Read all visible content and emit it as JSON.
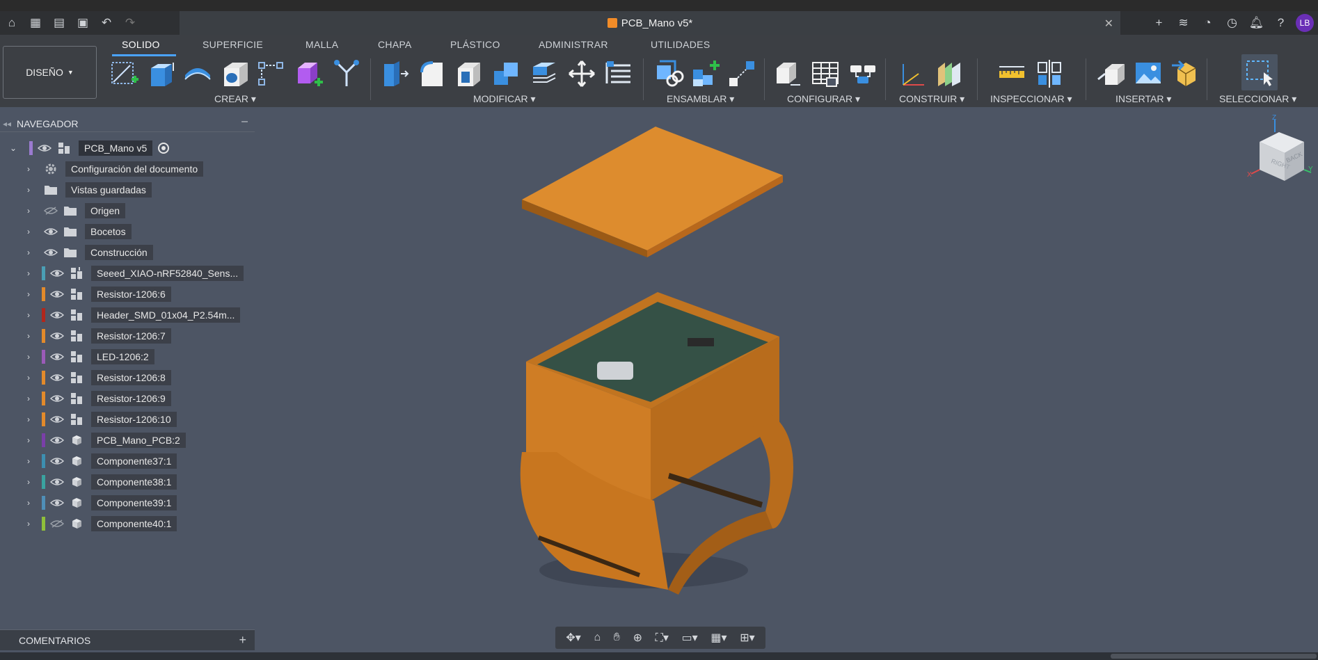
{
  "app": {
    "document_title": "PCB_Mano v5*",
    "user_initials": "LB"
  },
  "ribbon": {
    "workspace": "DISEÑO",
    "tabs": [
      "SOLIDO",
      "SUPERFICIE",
      "MALLA",
      "CHAPA",
      "PLÁSTICO",
      "ADMINISTRAR",
      "UTILIDADES"
    ],
    "active_tab": "SOLIDO",
    "groups": {
      "crear": "CREAR",
      "modificar": "MODIFICAR",
      "ensamblar": "ENSAMBLAR",
      "configurar": "CONFIGURAR",
      "construir": "CONSTRUIR",
      "inspeccionar": "INSPECCIONAR",
      "insertar": "INSERTAR",
      "seleccionar": "SELECCIONAR"
    }
  },
  "browser": {
    "title": "NAVEGADOR",
    "root": "PCB_Mano v5",
    "items": [
      {
        "label": "Configuración del documento",
        "icon": "gear-icon",
        "eye": "none",
        "color": ""
      },
      {
        "label": "Vistas guardadas",
        "icon": "folder-icon",
        "eye": "none",
        "color": ""
      },
      {
        "label": "Origen",
        "icon": "folder-icon",
        "eye": "hidden",
        "color": ""
      },
      {
        "label": "Bocetos",
        "icon": "folder-icon",
        "eye": "visible",
        "color": ""
      },
      {
        "label": "Construcción",
        "icon": "folder-icon",
        "eye": "visible",
        "color": ""
      },
      {
        "label": "Seeed_XIAO-nRF52840_Sens...",
        "icon": "component-link-icon",
        "eye": "visible",
        "color": "#4a9fb5"
      },
      {
        "label": "Resistor-1206:6",
        "icon": "component-icon",
        "eye": "visible",
        "color": "#e28a2b"
      },
      {
        "label": "Header_SMD_01x04_P2.54m...",
        "icon": "component-icon",
        "eye": "visible",
        "color": "#b0271c"
      },
      {
        "label": "Resistor-1206:7",
        "icon": "component-icon",
        "eye": "visible",
        "color": "#e28a2b"
      },
      {
        "label": "LED-1206:2",
        "icon": "component-icon",
        "eye": "visible",
        "color": "#9b5bb8"
      },
      {
        "label": "Resistor-1206:8",
        "icon": "component-icon",
        "eye": "visible",
        "color": "#e28a2b"
      },
      {
        "label": "Resistor-1206:9",
        "icon": "component-icon",
        "eye": "visible",
        "color": "#e28a2b"
      },
      {
        "label": "Resistor-1206:10",
        "icon": "component-icon",
        "eye": "visible",
        "color": "#e28a2b"
      },
      {
        "label": "PCB_Mano_PCB:2",
        "icon": "body-icon",
        "eye": "visible",
        "color": "#7a3fa8"
      },
      {
        "label": "Componente37:1",
        "icon": "body-icon",
        "eye": "visible",
        "color": "#3d8fb0"
      },
      {
        "label": "Componente38:1",
        "icon": "body-icon",
        "eye": "visible",
        "color": "#3aa3a0"
      },
      {
        "label": "Componente39:1",
        "icon": "body-icon",
        "eye": "visible",
        "color": "#4f8fb8"
      },
      {
        "label": "Componente40:1",
        "icon": "body-icon",
        "eye": "hidden",
        "color": "#8fbf3a"
      }
    ]
  },
  "comments": {
    "title": "COMENTARIOS"
  },
  "viewcube": {
    "faces": [
      "RIGHT",
      "BACK"
    ],
    "axes": [
      "Z",
      "Y",
      "X"
    ]
  },
  "colors": {
    "model_orange": "#d9892e",
    "pcb_green": "#3e5a4f",
    "viewport_bg": "#4d5564",
    "accent": "#4aa3ff"
  }
}
